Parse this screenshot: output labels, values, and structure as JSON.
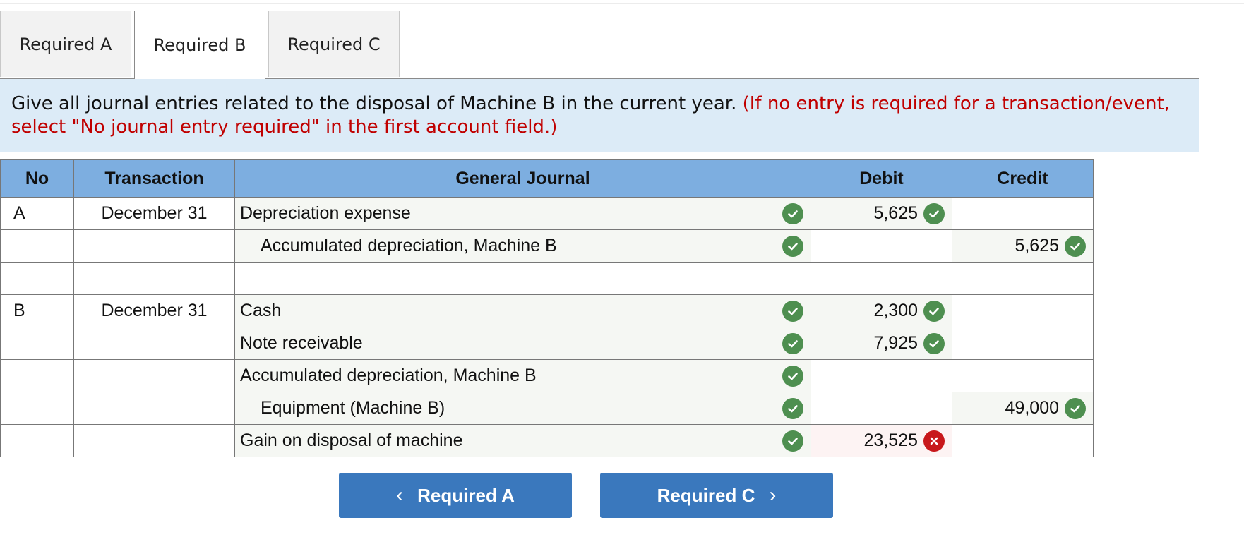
{
  "tabs": [
    {
      "label": "Required A",
      "active": false
    },
    {
      "label": "Required B",
      "active": true
    },
    {
      "label": "Required C",
      "active": false
    }
  ],
  "instructions": {
    "main": "Give all journal entries related to the disposal of Machine B in the current year.",
    "note": "(If no entry is required for a transaction/event, select \"No journal entry required\" in the first account field.)"
  },
  "table": {
    "headers": {
      "no": "No",
      "transaction": "Transaction",
      "journal": "General Journal",
      "debit": "Debit",
      "credit": "Credit"
    },
    "rows": [
      {
        "no": "A",
        "transaction": "December 31",
        "account": "Depreciation expense",
        "account_status": "correct",
        "debit": "5,625",
        "debit_status": "correct",
        "credit": "",
        "credit_status": ""
      },
      {
        "no": "",
        "transaction": "",
        "account": "Accumulated depreciation, Machine B",
        "account_status": "correct",
        "debit": "",
        "debit_status": "",
        "credit": "5,625",
        "credit_status": "correct"
      },
      {
        "no": "",
        "transaction": "",
        "account": "",
        "account_status": "",
        "debit": "",
        "debit_status": "",
        "credit": "",
        "credit_status": ""
      },
      {
        "no": "B",
        "transaction": "December 31",
        "account": "Cash",
        "account_status": "correct",
        "debit": "2,300",
        "debit_status": "correct",
        "credit": "",
        "credit_status": ""
      },
      {
        "no": "",
        "transaction": "",
        "account": "Note receivable",
        "account_status": "correct",
        "debit": "7,925",
        "debit_status": "correct",
        "credit": "",
        "credit_status": ""
      },
      {
        "no": "",
        "transaction": "",
        "account": "Accumulated depreciation, Machine B",
        "account_status": "correct",
        "debit": "",
        "debit_status": "",
        "credit": "",
        "credit_status": ""
      },
      {
        "no": "",
        "transaction": "",
        "account": "Equipment (Machine B)",
        "account_status": "correct",
        "debit": "",
        "debit_status": "",
        "credit": "49,000",
        "credit_status": "correct"
      },
      {
        "no": "",
        "transaction": "",
        "account": "Gain on disposal of machine",
        "account_status": "correct",
        "debit": "23,525",
        "debit_status": "incorrect",
        "credit": "",
        "credit_status": ""
      }
    ]
  },
  "nav": {
    "prev_label": "Required A",
    "next_label": "Required C"
  },
  "colors": {
    "header_bg": "#7daee0",
    "instruction_bg": "#dcebf7",
    "note_red": "#c00000",
    "correct_green": "#4e8f50",
    "incorrect_red": "#c8181b",
    "button_blue": "#3a78bd"
  },
  "icons": {
    "correct": "check-circle-icon",
    "incorrect": "x-circle-icon",
    "prev": "chevron-left-icon",
    "next": "chevron-right-icon"
  }
}
